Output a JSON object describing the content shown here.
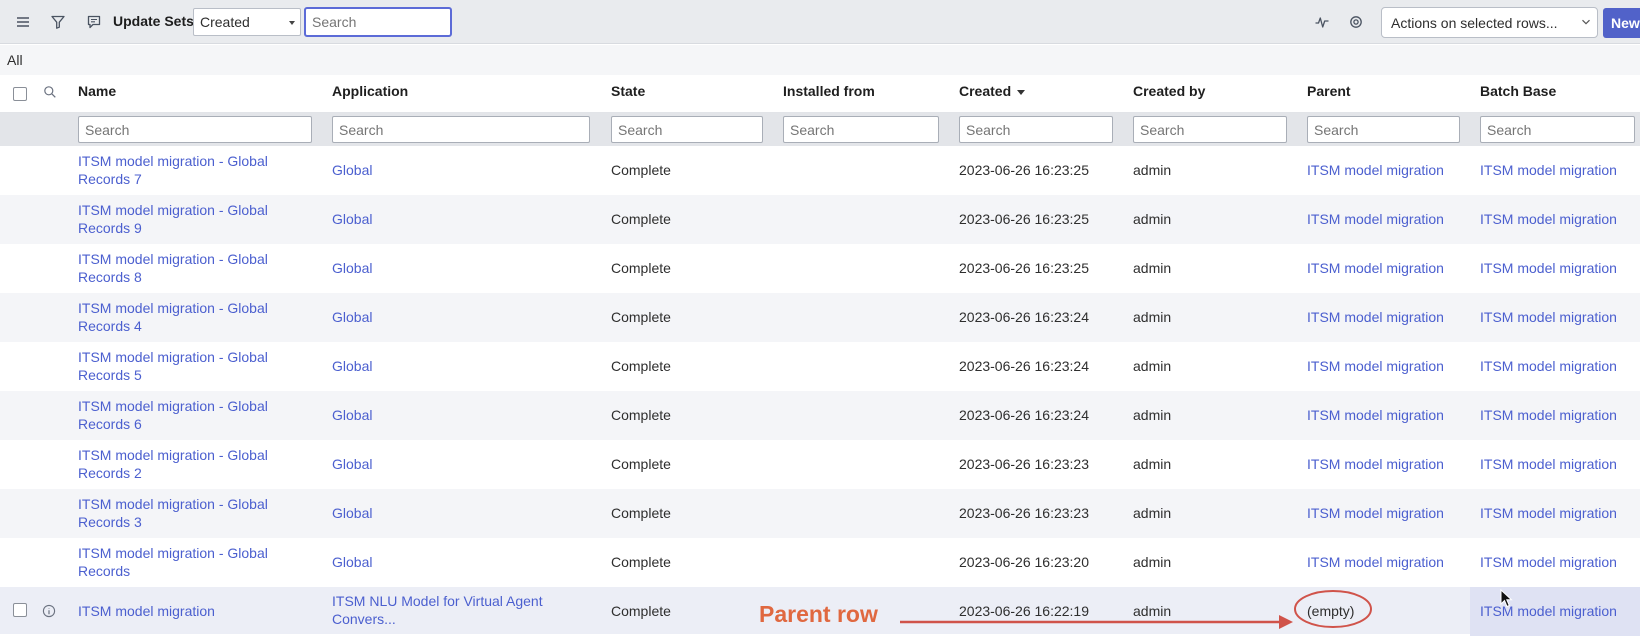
{
  "header": {
    "title": "Update Sets",
    "filter_field": "Created",
    "search_placeholder": "Search",
    "actions_label": "Actions on selected rows...",
    "new_label": "New"
  },
  "breadcrumb": {
    "label": "All"
  },
  "columns": [
    "Name",
    "Application",
    "State",
    "Installed from",
    "Created",
    "Created by",
    "Parent",
    "Batch Base"
  ],
  "column_search_placeholder": "Search",
  "rows": [
    {
      "name_line1": "ITSM model migration - Global",
      "name_line2": "Records 7",
      "application": "Global",
      "application_line2": "",
      "state": "Complete",
      "installed_from": "",
      "created": "2023-06-26 16:23:25",
      "created_by": "admin",
      "parent": "ITSM model migration",
      "batch_base": "ITSM model migration"
    },
    {
      "name_line1": "ITSM model migration - Global",
      "name_line2": "Records 9",
      "application": "Global",
      "application_line2": "",
      "state": "Complete",
      "installed_from": "",
      "created": "2023-06-26 16:23:25",
      "created_by": "admin",
      "parent": "ITSM model migration",
      "batch_base": "ITSM model migration"
    },
    {
      "name_line1": "ITSM model migration - Global",
      "name_line2": "Records 8",
      "application": "Global",
      "application_line2": "",
      "state": "Complete",
      "installed_from": "",
      "created": "2023-06-26 16:23:25",
      "created_by": "admin",
      "parent": "ITSM model migration",
      "batch_base": "ITSM model migration"
    },
    {
      "name_line1": "ITSM model migration - Global",
      "name_line2": "Records 4",
      "application": "Global",
      "application_line2": "",
      "state": "Complete",
      "installed_from": "",
      "created": "2023-06-26 16:23:24",
      "created_by": "admin",
      "parent": "ITSM model migration",
      "batch_base": "ITSM model migration"
    },
    {
      "name_line1": "ITSM model migration - Global",
      "name_line2": "Records 5",
      "application": "Global",
      "application_line2": "",
      "state": "Complete",
      "installed_from": "",
      "created": "2023-06-26 16:23:24",
      "created_by": "admin",
      "parent": "ITSM model migration",
      "batch_base": "ITSM model migration"
    },
    {
      "name_line1": "ITSM model migration - Global",
      "name_line2": "Records 6",
      "application": "Global",
      "application_line2": "",
      "state": "Complete",
      "installed_from": "",
      "created": "2023-06-26 16:23:24",
      "created_by": "admin",
      "parent": "ITSM model migration",
      "batch_base": "ITSM model migration"
    },
    {
      "name_line1": "ITSM model migration - Global",
      "name_line2": "Records 2",
      "application": "Global",
      "application_line2": "",
      "state": "Complete",
      "installed_from": "",
      "created": "2023-06-26 16:23:23",
      "created_by": "admin",
      "parent": "ITSM model migration",
      "batch_base": "ITSM model migration"
    },
    {
      "name_line1": "ITSM model migration - Global",
      "name_line2": "Records 3",
      "application": "Global",
      "application_line2": "",
      "state": "Complete",
      "installed_from": "",
      "created": "2023-06-26 16:23:23",
      "created_by": "admin",
      "parent": "ITSM model migration",
      "batch_base": "ITSM model migration"
    },
    {
      "name_line1": "ITSM model migration - Global",
      "name_line2": "Records",
      "application": "Global",
      "application_line2": "",
      "state": "Complete",
      "installed_from": "",
      "created": "2023-06-26 16:23:20",
      "created_by": "admin",
      "parent": "ITSM model migration",
      "batch_base": "ITSM model migration"
    },
    {
      "name_line1": "ITSM model migration",
      "name_line2": "",
      "application": "ITSM NLU Model for Virtual Agent",
      "application_line2": "Convers...",
      "state": "Complete",
      "installed_from": "",
      "created": "2023-06-26 16:22:19",
      "created_by": "admin",
      "parent": "(empty)",
      "batch_base": "ITSM model migration"
    }
  ],
  "annotation": {
    "label": "Parent row",
    "color": "#e06840"
  },
  "colors": {
    "accent": "#5c6bd7",
    "link": "#4b5fcf",
    "header_bg": "#e9ebee"
  }
}
